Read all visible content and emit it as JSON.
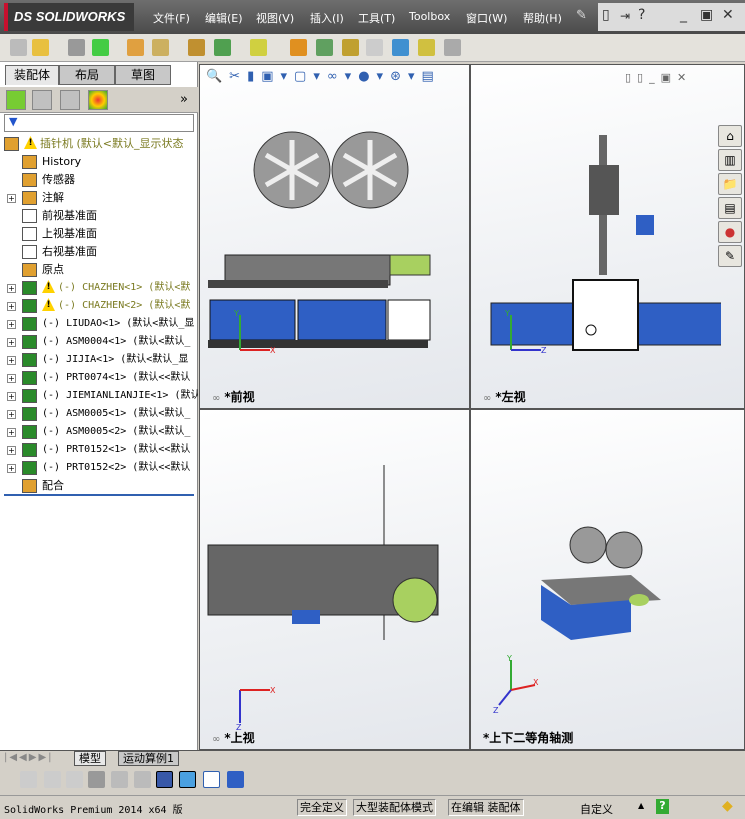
{
  "app": {
    "brand": "SOLIDWORKS",
    "brand_prefix": "DS"
  },
  "menu": [
    "文件(F)",
    "编辑(E)",
    "视图(V)",
    "插入(I)",
    "工具(T)",
    "Toolbox",
    "窗口(W)",
    "帮助(H)"
  ],
  "left_tabs": [
    "装配体",
    "布局",
    "草图"
  ],
  "tree": [
    {
      "label": "插针机 (默认<默认_显示状态",
      "warn": true,
      "top": true
    },
    {
      "label": "History"
    },
    {
      "label": "传感器"
    },
    {
      "label": "注解",
      "exp": true
    },
    {
      "label": "前视基准面"
    },
    {
      "label": "上视基准面"
    },
    {
      "label": "右视基准面"
    },
    {
      "label": "原点"
    },
    {
      "label": "(-) CHAZHEN<1> (默认<默",
      "exp": true,
      "warn": true
    },
    {
      "label": "(-) CHAZHEN<2> (默认<默",
      "exp": true,
      "warn": true
    },
    {
      "label": "(-) LIUDAO<1> (默认<默认_显",
      "exp": true
    },
    {
      "label": "(-) ASM0004<1> (默认<默认_",
      "exp": true
    },
    {
      "label": "(-) JIJIA<1> (默认<默认_显",
      "exp": true
    },
    {
      "label": "(-) PRT0074<1> (默认<<默认",
      "exp": true
    },
    {
      "label": "(-) JIEMIANLIANJIE<1> (默认",
      "exp": true
    },
    {
      "label": "(-) ASM0005<1> (默认<默认_",
      "exp": true
    },
    {
      "label": "(-) ASM0005<2> (默认<默认_",
      "exp": true
    },
    {
      "label": "(-) PRT0152<1> (默认<<默认",
      "exp": true
    },
    {
      "label": "(-) PRT0152<2> (默认<<默认",
      "exp": true
    },
    {
      "label": "配合"
    }
  ],
  "viewports": {
    "front": "*前视",
    "left": "*左视",
    "top": "*上视",
    "iso": "*上下二等角轴测"
  },
  "bottom_tabs": [
    "模型",
    "运动算例1"
  ],
  "status": {
    "product": "SolidWorks Premium 2014 x64 版",
    "defined": "完全定义",
    "mode": "大型装配体模式",
    "editing": "在编辑 装配体",
    "custom": "自定义"
  },
  "colors": {
    "accent": "#c8102e",
    "machine_blue": "#2f5fc4",
    "hopper": "#a8d060"
  }
}
